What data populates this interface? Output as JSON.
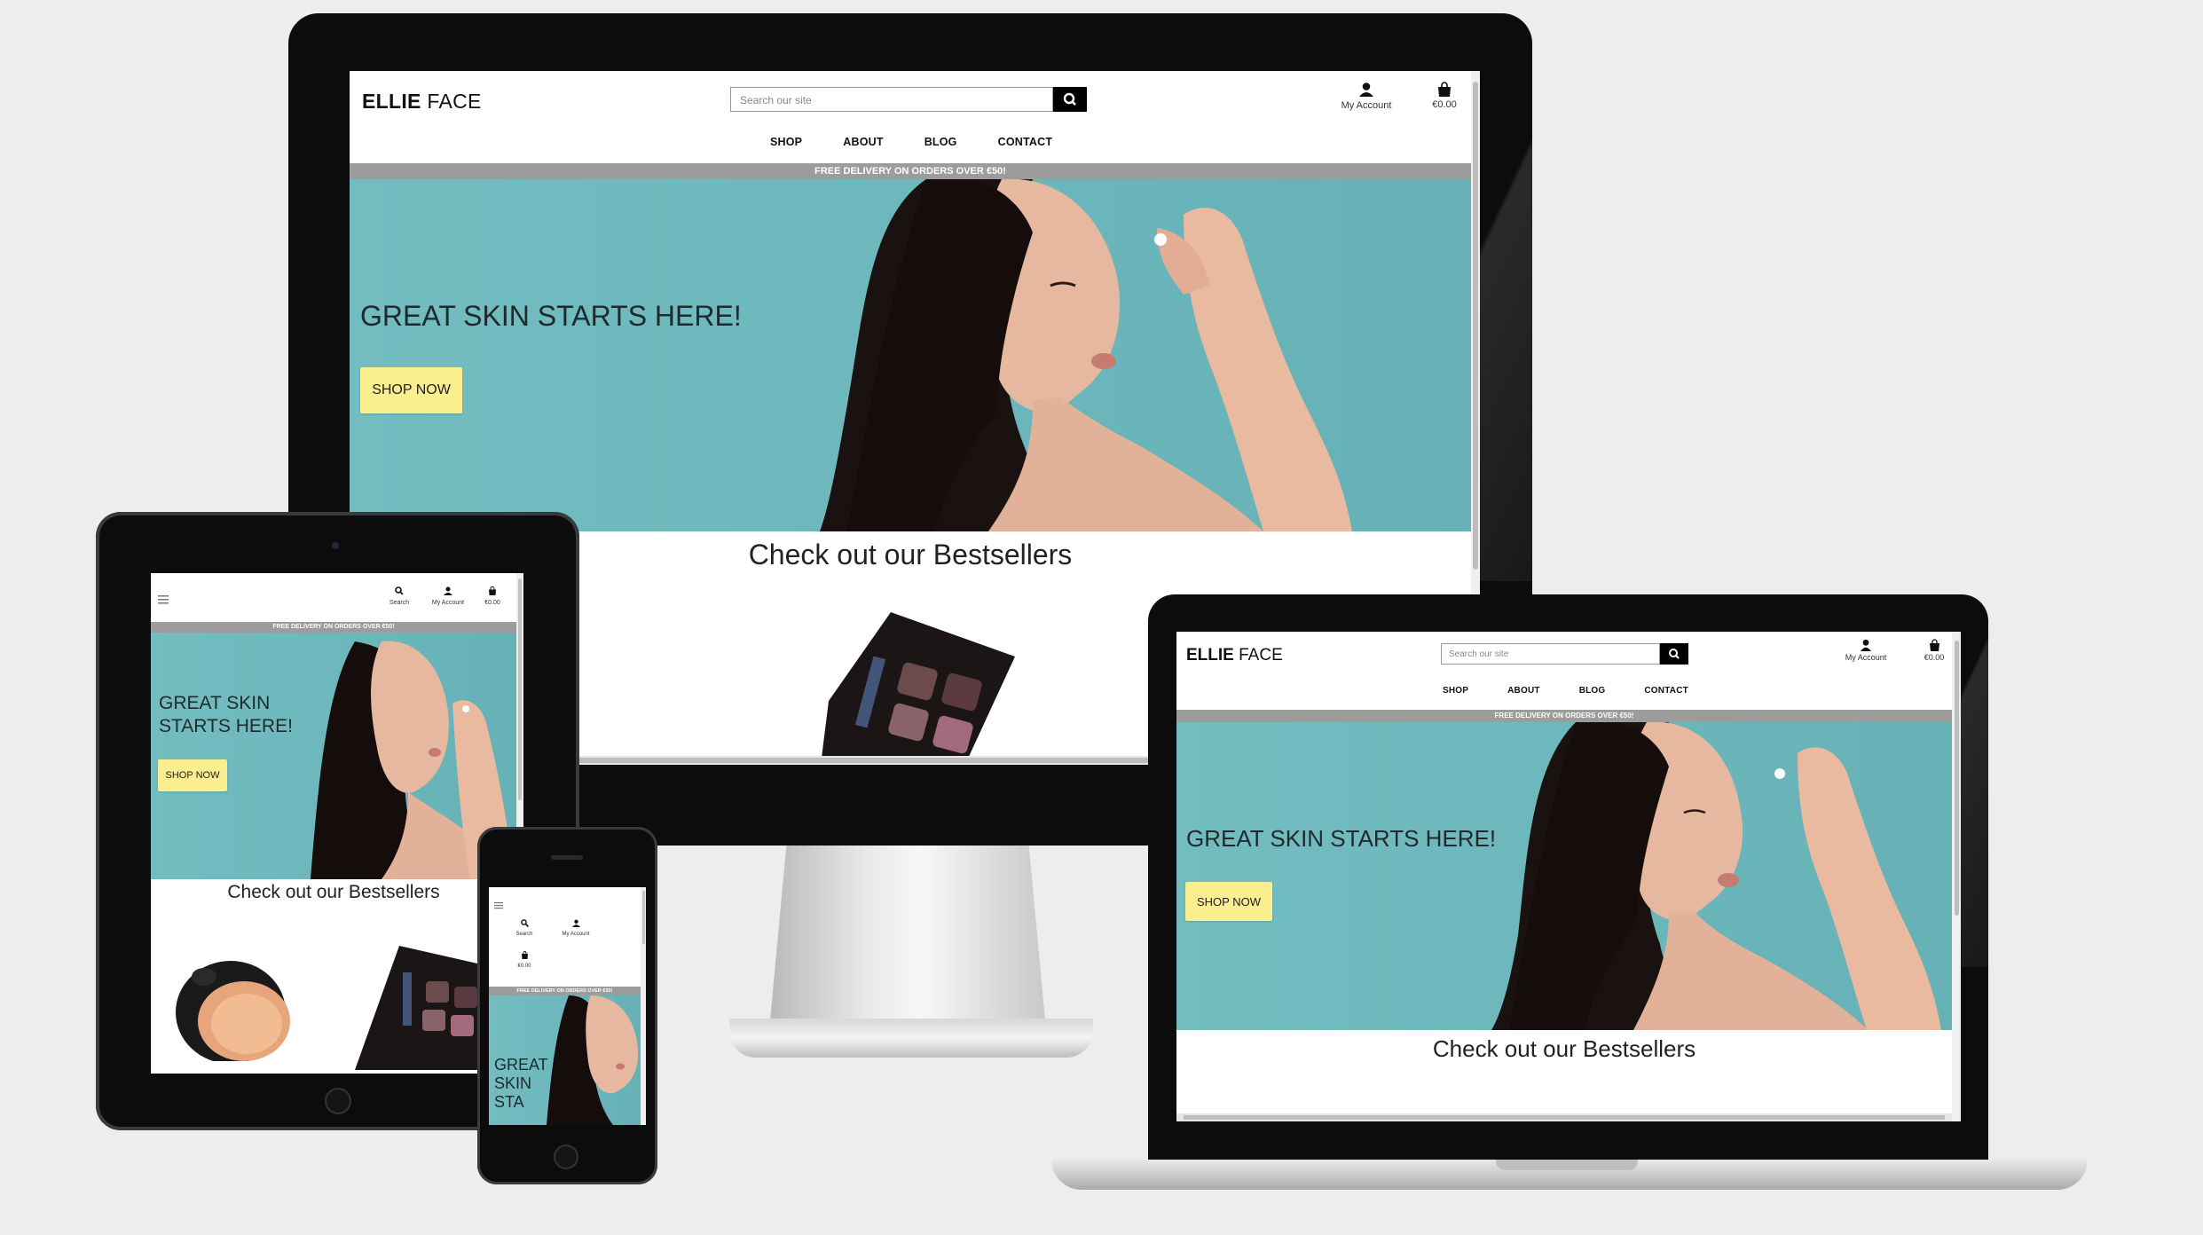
{
  "brand": {
    "bold": "ELLIE",
    "light": " FACE"
  },
  "search": {
    "placeholder": "Search our site",
    "label": "Search"
  },
  "account": {
    "label": "My Account"
  },
  "cart": {
    "total": "€0.00"
  },
  "nav": {
    "shop": "SHOP",
    "about": "ABOUT",
    "blog": "BLOG",
    "contact": "CONTACT"
  },
  "banner": {
    "text": "FREE DELIVERY ON ORDERS OVER €50!"
  },
  "hero": {
    "title": "GREAT SKIN STARTS HERE!",
    "title_line1": "GREAT SKIN",
    "title_line2": "STARTS HERE!",
    "phone_lines": [
      "GREAT",
      "SKIN",
      "STA"
    ],
    "cta": "SHOP NOW"
  },
  "section": {
    "bestsellers": "Check out our Bestsellers"
  },
  "colors": {
    "hero_bg": "#6cb7bc",
    "banner": "#9c9c9c",
    "cta_bg": "#fbee8f",
    "page_bg": "#ededee"
  }
}
